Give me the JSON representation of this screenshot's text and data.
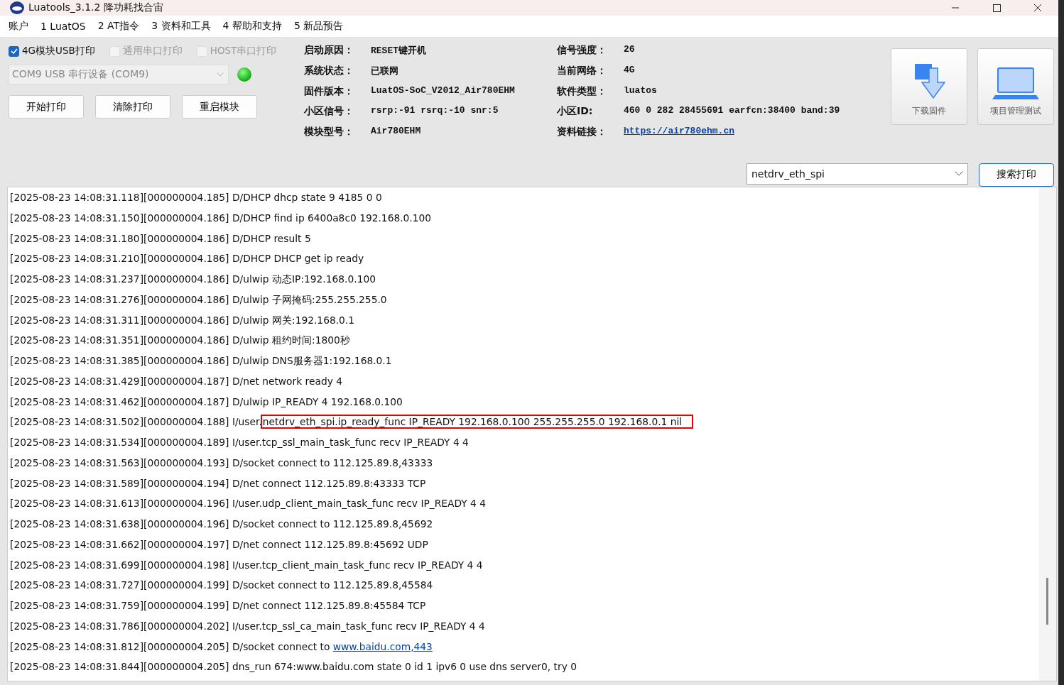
{
  "window": {
    "title": "Luatools_3.1.2 降功耗找合宙"
  },
  "menu": [
    "账户",
    "1 LuatOS",
    "2 AT指令",
    "3 资料和工具",
    "4 帮助和支持",
    "5 新品预告"
  ],
  "print_options": [
    {
      "label": "4G模块USB打印",
      "checked": true,
      "disabled": false
    },
    {
      "label": "通用串口打印",
      "checked": false,
      "disabled": true
    },
    {
      "label": "HOST串口打印",
      "checked": false,
      "disabled": true
    }
  ],
  "port": {
    "value": "COM9 USB 串行设备 (COM9)",
    "connected": true
  },
  "buttons": [
    "开始打印",
    "清除打印",
    "重启模块"
  ],
  "info_columns": [
    [
      {
        "label": "启动原因：",
        "value": "RESET键开机",
        "kind": "text"
      },
      {
        "label": "系统状态：",
        "value": "已联网",
        "kind": "text"
      },
      {
        "label": "固件版本：",
        "value": "LuatOS-SoC_V2012_Air780EHM",
        "kind": "text"
      },
      {
        "label": "小区信号：",
        "value": "rsrp:-91 rsrq:-10 snr:5",
        "kind": "text"
      },
      {
        "label": "模块型号：",
        "value": "Air780EHM",
        "kind": "text"
      }
    ],
    [
      {
        "label": "信号强度：",
        "value": "26",
        "kind": "text"
      },
      {
        "label": "当前网络：",
        "value": "4G",
        "kind": "text"
      },
      {
        "label": "软件类型：",
        "value": "luatos",
        "kind": "text"
      },
      {
        "label": "小区ID:",
        "value": "460 0 282 28455691 earfcn:38400 band:39",
        "kind": "text"
      },
      {
        "label": "资料链接：",
        "value": "https://air780ehm.cn",
        "kind": "link"
      }
    ]
  ],
  "tool_buttons": [
    {
      "label": "下载固件",
      "kind": "download"
    },
    {
      "label": "项目管理测试",
      "kind": "project"
    }
  ],
  "search": {
    "value": "netdrv_eth_spi",
    "button": "搜索打印"
  },
  "log": [
    {
      "kind": "plain",
      "text": "[2025-08-23 14:08:31.118][000000004.185] D/DHCP dhcp state 9 4185 0 0"
    },
    {
      "kind": "plain",
      "text": "[2025-08-23 14:08:31.150][000000004.186] D/DHCP find ip 6400a8c0 192.168.0.100"
    },
    {
      "kind": "plain",
      "text": "[2025-08-23 14:08:31.180][000000004.186] D/DHCP result 5"
    },
    {
      "kind": "plain",
      "text": "[2025-08-23 14:08:31.210][000000004.186] D/DHCP DHCP get ip ready"
    },
    {
      "kind": "plain",
      "text": "[2025-08-23 14:08:31.237][000000004.186] D/ulwip 动态IP:192.168.0.100"
    },
    {
      "kind": "plain",
      "text": "[2025-08-23 14:08:31.276][000000004.186] D/ulwip 子网掩码:255.255.255.0"
    },
    {
      "kind": "plain",
      "text": "[2025-08-23 14:08:31.311][000000004.186] D/ulwip 网关:192.168.0.1"
    },
    {
      "kind": "plain",
      "text": "[2025-08-23 14:08:31.351][000000004.186] D/ulwip 租约时间:1800秒"
    },
    {
      "kind": "plain",
      "text": "[2025-08-23 14:08:31.385][000000004.186] D/ulwip DNS服务器1:192.168.0.1"
    },
    {
      "kind": "plain",
      "text": "[2025-08-23 14:08:31.429][000000004.187] D/net network ready 4"
    },
    {
      "kind": "plain",
      "text": "[2025-08-23 14:08:31.462][000000004.187] D/ulwip IP_READY 4 192.168.0.100"
    },
    {
      "kind": "highlight",
      "text": "[2025-08-23 14:08:31.502][000000004.188] I/user.",
      "extra": "netdrv_eth_spi.ip_ready_func IP_READY 192.168.0.100 255.255.255.0 192.168.0.1 nil"
    },
    {
      "kind": "plain",
      "text": "[2025-08-23 14:08:31.534][000000004.189] I/user.tcp_ssl_main_task_func recv IP_READY 4 4"
    },
    {
      "kind": "plain",
      "text": "[2025-08-23 14:08:31.563][000000004.193] D/socket connect to 112.125.89.8,43333"
    },
    {
      "kind": "plain",
      "text": "[2025-08-23 14:08:31.589][000000004.194] D/net connect 112.125.89.8:43333 TCP"
    },
    {
      "kind": "plain",
      "text": "[2025-08-23 14:08:31.613][000000004.196] I/user.udp_client_main_task_func recv IP_READY 4 4"
    },
    {
      "kind": "plain",
      "text": "[2025-08-23 14:08:31.638][000000004.196] D/socket connect to 112.125.89.8,45692"
    },
    {
      "kind": "plain",
      "text": "[2025-08-23 14:08:31.662][000000004.197] D/net connect 112.125.89.8:45692 UDP"
    },
    {
      "kind": "plain",
      "text": "[2025-08-23 14:08:31.699][000000004.198] I/user.tcp_client_main_task_func recv IP_READY 4 4"
    },
    {
      "kind": "plain",
      "text": "[2025-08-23 14:08:31.727][000000004.199] D/socket connect to 112.125.89.8,45584"
    },
    {
      "kind": "plain",
      "text": "[2025-08-23 14:08:31.759][000000004.199] D/net connect 112.125.89.8:45584 TCP"
    },
    {
      "kind": "plain",
      "text": "[2025-08-23 14:08:31.786][000000004.202] I/user.tcp_ssl_ca_main_task_func recv IP_READY 4 4"
    },
    {
      "kind": "link",
      "text": "[2025-08-23 14:08:31.812][000000004.205] D/socket connect to",
      "extra": "www.baidu.com,443"
    },
    {
      "kind": "plain",
      "text": "[2025-08-23 14:08:31.844][000000004.205] dns_run 674:www.baidu.com state 0 id 1 ipv6 0 use dns server0, try 0"
    }
  ]
}
